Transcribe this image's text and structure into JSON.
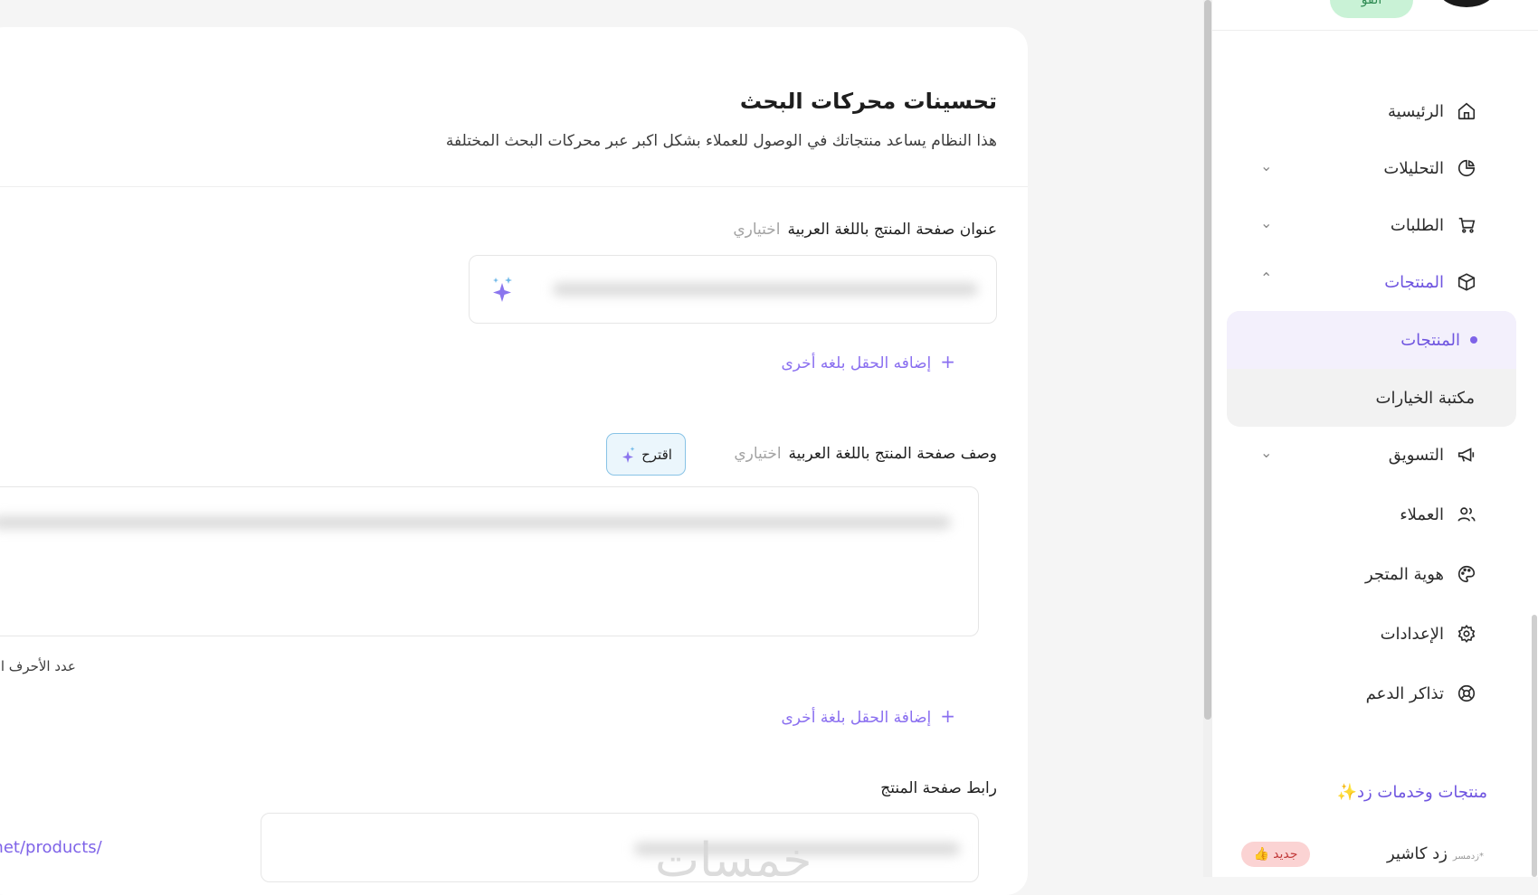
{
  "main": {
    "title": "تحسينات محركات البحث",
    "subtitle": "هذا النظام يساعد منتجاتك في الوصول للعملاء بشكل اكبر عبر محركات البحث المختلفة",
    "title_field": {
      "label": "عنوان صفحة المنتج باللغة العربية",
      "optional": "اختياري",
      "add_language": "إضافه الحقل بلغه أخرى"
    },
    "description_field": {
      "label": "وصف صفحة المنتج باللغة العربية",
      "optional": "اختياري",
      "suggest_button": "اقترح",
      "char_count_label": "عدد الأحرف المستخ",
      "add_language": "إضافة الحقل بلغة أخرى"
    },
    "url_field": {
      "label": "رابط صفحة المنتج",
      "prefix": "o.net/products/"
    },
    "watermark": "خمسات"
  },
  "sidebar": {
    "top_badge": "الفو",
    "items": [
      {
        "label": "الرئيسية",
        "icon": "home-icon"
      },
      {
        "label": "التحليلات",
        "icon": "pie-chart-icon"
      },
      {
        "label": "الطلبات",
        "icon": "cart-icon"
      },
      {
        "label": "المنتجات",
        "icon": "box-icon"
      },
      {
        "label": "المنتجات",
        "icon": "bullet-dot"
      },
      {
        "label": "مكتبة الخيارات",
        "icon": ""
      },
      {
        "label": "التسويق",
        "icon": "megaphone-icon"
      },
      {
        "label": "العملاء",
        "icon": "users-icon"
      },
      {
        "label": "هوية المتجر",
        "icon": "palette-icon"
      },
      {
        "label": "الإعدادات",
        "icon": "gear-icon"
      },
      {
        "label": "تذاكر الدعم",
        "icon": "lifebuoy-icon"
      }
    ],
    "promo_title": "منتجات وخدمات زد",
    "cashier_label": "زد كاشير",
    "cashier_brand": "*زدمسر",
    "new_badge": "جديد"
  },
  "colors": {
    "accent": "#7e63e8",
    "text": "#1e1e1e",
    "suggest_border": "#88c3e6",
    "new_badge_bg": "#fbd3d3"
  }
}
